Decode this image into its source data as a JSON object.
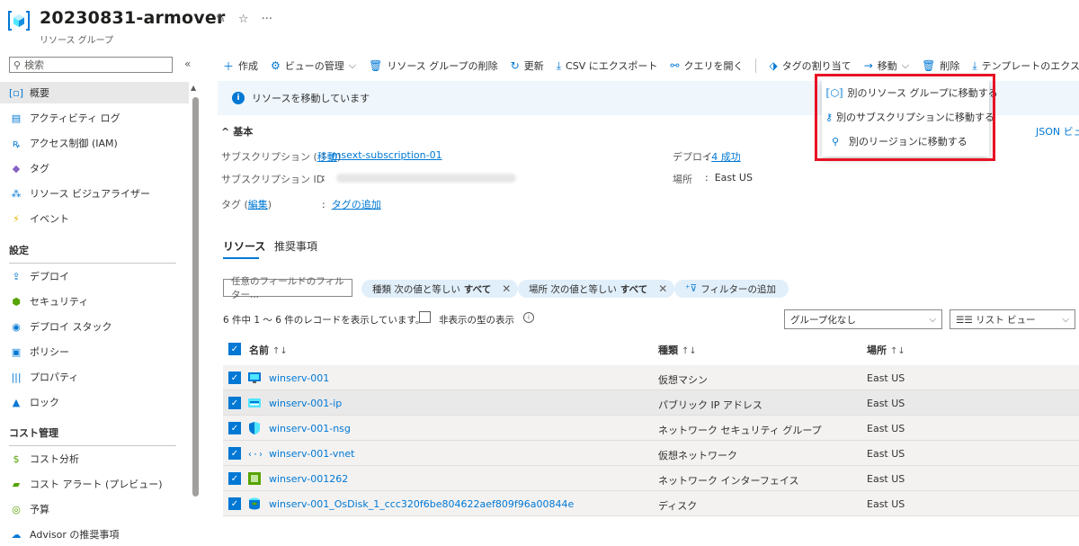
{
  "header": {
    "title": "20230831-armover",
    "subtitle": "リソース グループ"
  },
  "sidebar": {
    "search_placeholder": "検索",
    "items": [
      {
        "label": "概要",
        "icon": "overview-icon",
        "glyph": "[▫]",
        "color": "#0078d4"
      },
      {
        "label": "アクティビティ ログ",
        "icon": "activity-log-icon",
        "glyph": "▤",
        "color": "#0078d4"
      },
      {
        "label": "アクセス制御 (IAM)",
        "icon": "iam-icon",
        "glyph": "ꝶ",
        "color": "#0078d4"
      },
      {
        "label": "タグ",
        "icon": "tag-icon",
        "glyph": "◆",
        "color": "#8661c5"
      },
      {
        "label": "リソース ビジュアライザー",
        "icon": "visualizer-icon",
        "glyph": "⁂",
        "color": "#0078d4"
      },
      {
        "label": "イベント",
        "icon": "event-icon",
        "glyph": "⚡",
        "color": "#e8b100"
      }
    ],
    "section_settings": "設定",
    "settings_items": [
      {
        "label": "デプロイ",
        "icon": "deploy-icon",
        "glyph": "⇪",
        "color": "#0078d4"
      },
      {
        "label": "セキュリティ",
        "icon": "security-icon",
        "glyph": "⬢",
        "color": "#57a300"
      },
      {
        "label": "デプロイ スタック",
        "icon": "deploy-stack-icon",
        "glyph": "◉",
        "color": "#0078d4"
      },
      {
        "label": "ポリシー",
        "icon": "policy-icon",
        "glyph": "▣",
        "color": "#0078d4"
      },
      {
        "label": "プロパティ",
        "icon": "properties-icon",
        "glyph": "|||",
        "color": "#0078d4"
      },
      {
        "label": "ロック",
        "icon": "lock-icon",
        "glyph": "▲",
        "color": "#0078d4"
      }
    ],
    "section_cost": "コスト管理",
    "cost_items": [
      {
        "label": "コスト分析",
        "icon": "cost-analysis-icon",
        "glyph": "$",
        "color": "#57a300"
      },
      {
        "label": "コスト アラート (プレビュー)",
        "icon": "cost-alert-icon",
        "glyph": "▰",
        "color": "#57a300"
      },
      {
        "label": "予算",
        "icon": "budget-icon",
        "glyph": "◎",
        "color": "#57a300"
      },
      {
        "label": "Advisor の推奨事項",
        "icon": "advisor-icon",
        "glyph": "☁",
        "color": "#0078d4"
      }
    ]
  },
  "toolbar": {
    "create": "作成",
    "manage_view": "ビューの管理",
    "delete_rg": "リソース グループの削除",
    "refresh": "更新",
    "export_csv": "CSV にエクスポート",
    "open_query": "クエリを開く",
    "assign_tags": "タグの割り当て",
    "move": "移動",
    "delete": "削除",
    "export_template": "テンプレートのエクスポート"
  },
  "banner": {
    "text": "リソースを移動しています"
  },
  "essentials": {
    "header": "基本",
    "json_view": "JSON ビュー",
    "subscription_label": "サブスクリプション",
    "subscription_move": "移動",
    "subscription_value": "msext-subscription-01",
    "subscription_id_label": "サブスクリプション ID",
    "tags_label": "タグ",
    "tags_edit": "編集",
    "tags_add": "タグの追加",
    "deploy_label": "デプロイ",
    "deploy_value": "4 成功",
    "location_label": "場所",
    "location_value": "East US"
  },
  "tabs": {
    "resources": "リソース",
    "recommendations": "推奨事項"
  },
  "filters": {
    "placeholder": "任意のフィールドのフィルター...",
    "pill_type_key": "種類 次の値と等しい",
    "pill_type_val": "すべて",
    "pill_loc_key": "場所 次の値と等しい",
    "pill_loc_val": "すべて",
    "add_filter": "フィルターの追加"
  },
  "records": {
    "summary": "6 件中 1 ～ 6 件のレコードを表示しています。",
    "show_hidden": "非表示の型の表示",
    "grouping": "グループ化なし",
    "view": "☰☰ リスト ビュー"
  },
  "table": {
    "headers": {
      "name": "名前",
      "type": "種類",
      "location": "場所"
    },
    "rows": [
      {
        "name": "winserv-001",
        "type": "仮想マシン",
        "location": "East US",
        "icon": "vm-icon"
      },
      {
        "name": "winserv-001-ip",
        "type": "パブリック IP アドレス",
        "location": "East US",
        "icon": "public-ip-icon"
      },
      {
        "name": "winserv-001-nsg",
        "type": "ネットワーク セキュリティ グループ",
        "location": "East US",
        "icon": "nsg-shield-icon"
      },
      {
        "name": "winserv-001-vnet",
        "type": "仮想ネットワーク",
        "location": "East US",
        "icon": "vnet-icon"
      },
      {
        "name": "winserv-001262",
        "type": "ネットワーク インターフェイス",
        "location": "East US",
        "icon": "nic-icon"
      },
      {
        "name": "winserv-001_OsDisk_1_ccc320f6be804622aef809f96a00844e",
        "type": "ディスク",
        "location": "East US",
        "icon": "disk-icon"
      }
    ]
  },
  "move_menu": {
    "items": [
      {
        "label": "別のリソース グループに移動する",
        "icon": "resource-group-icon"
      },
      {
        "label": "別のサブスクリプションに移動する",
        "icon": "subscription-key-icon"
      },
      {
        "label": "別のリージョンに移動する",
        "icon": "region-pin-icon"
      }
    ]
  },
  "colors": {
    "accent": "#0078d4",
    "highlight_box": "#e81123"
  }
}
